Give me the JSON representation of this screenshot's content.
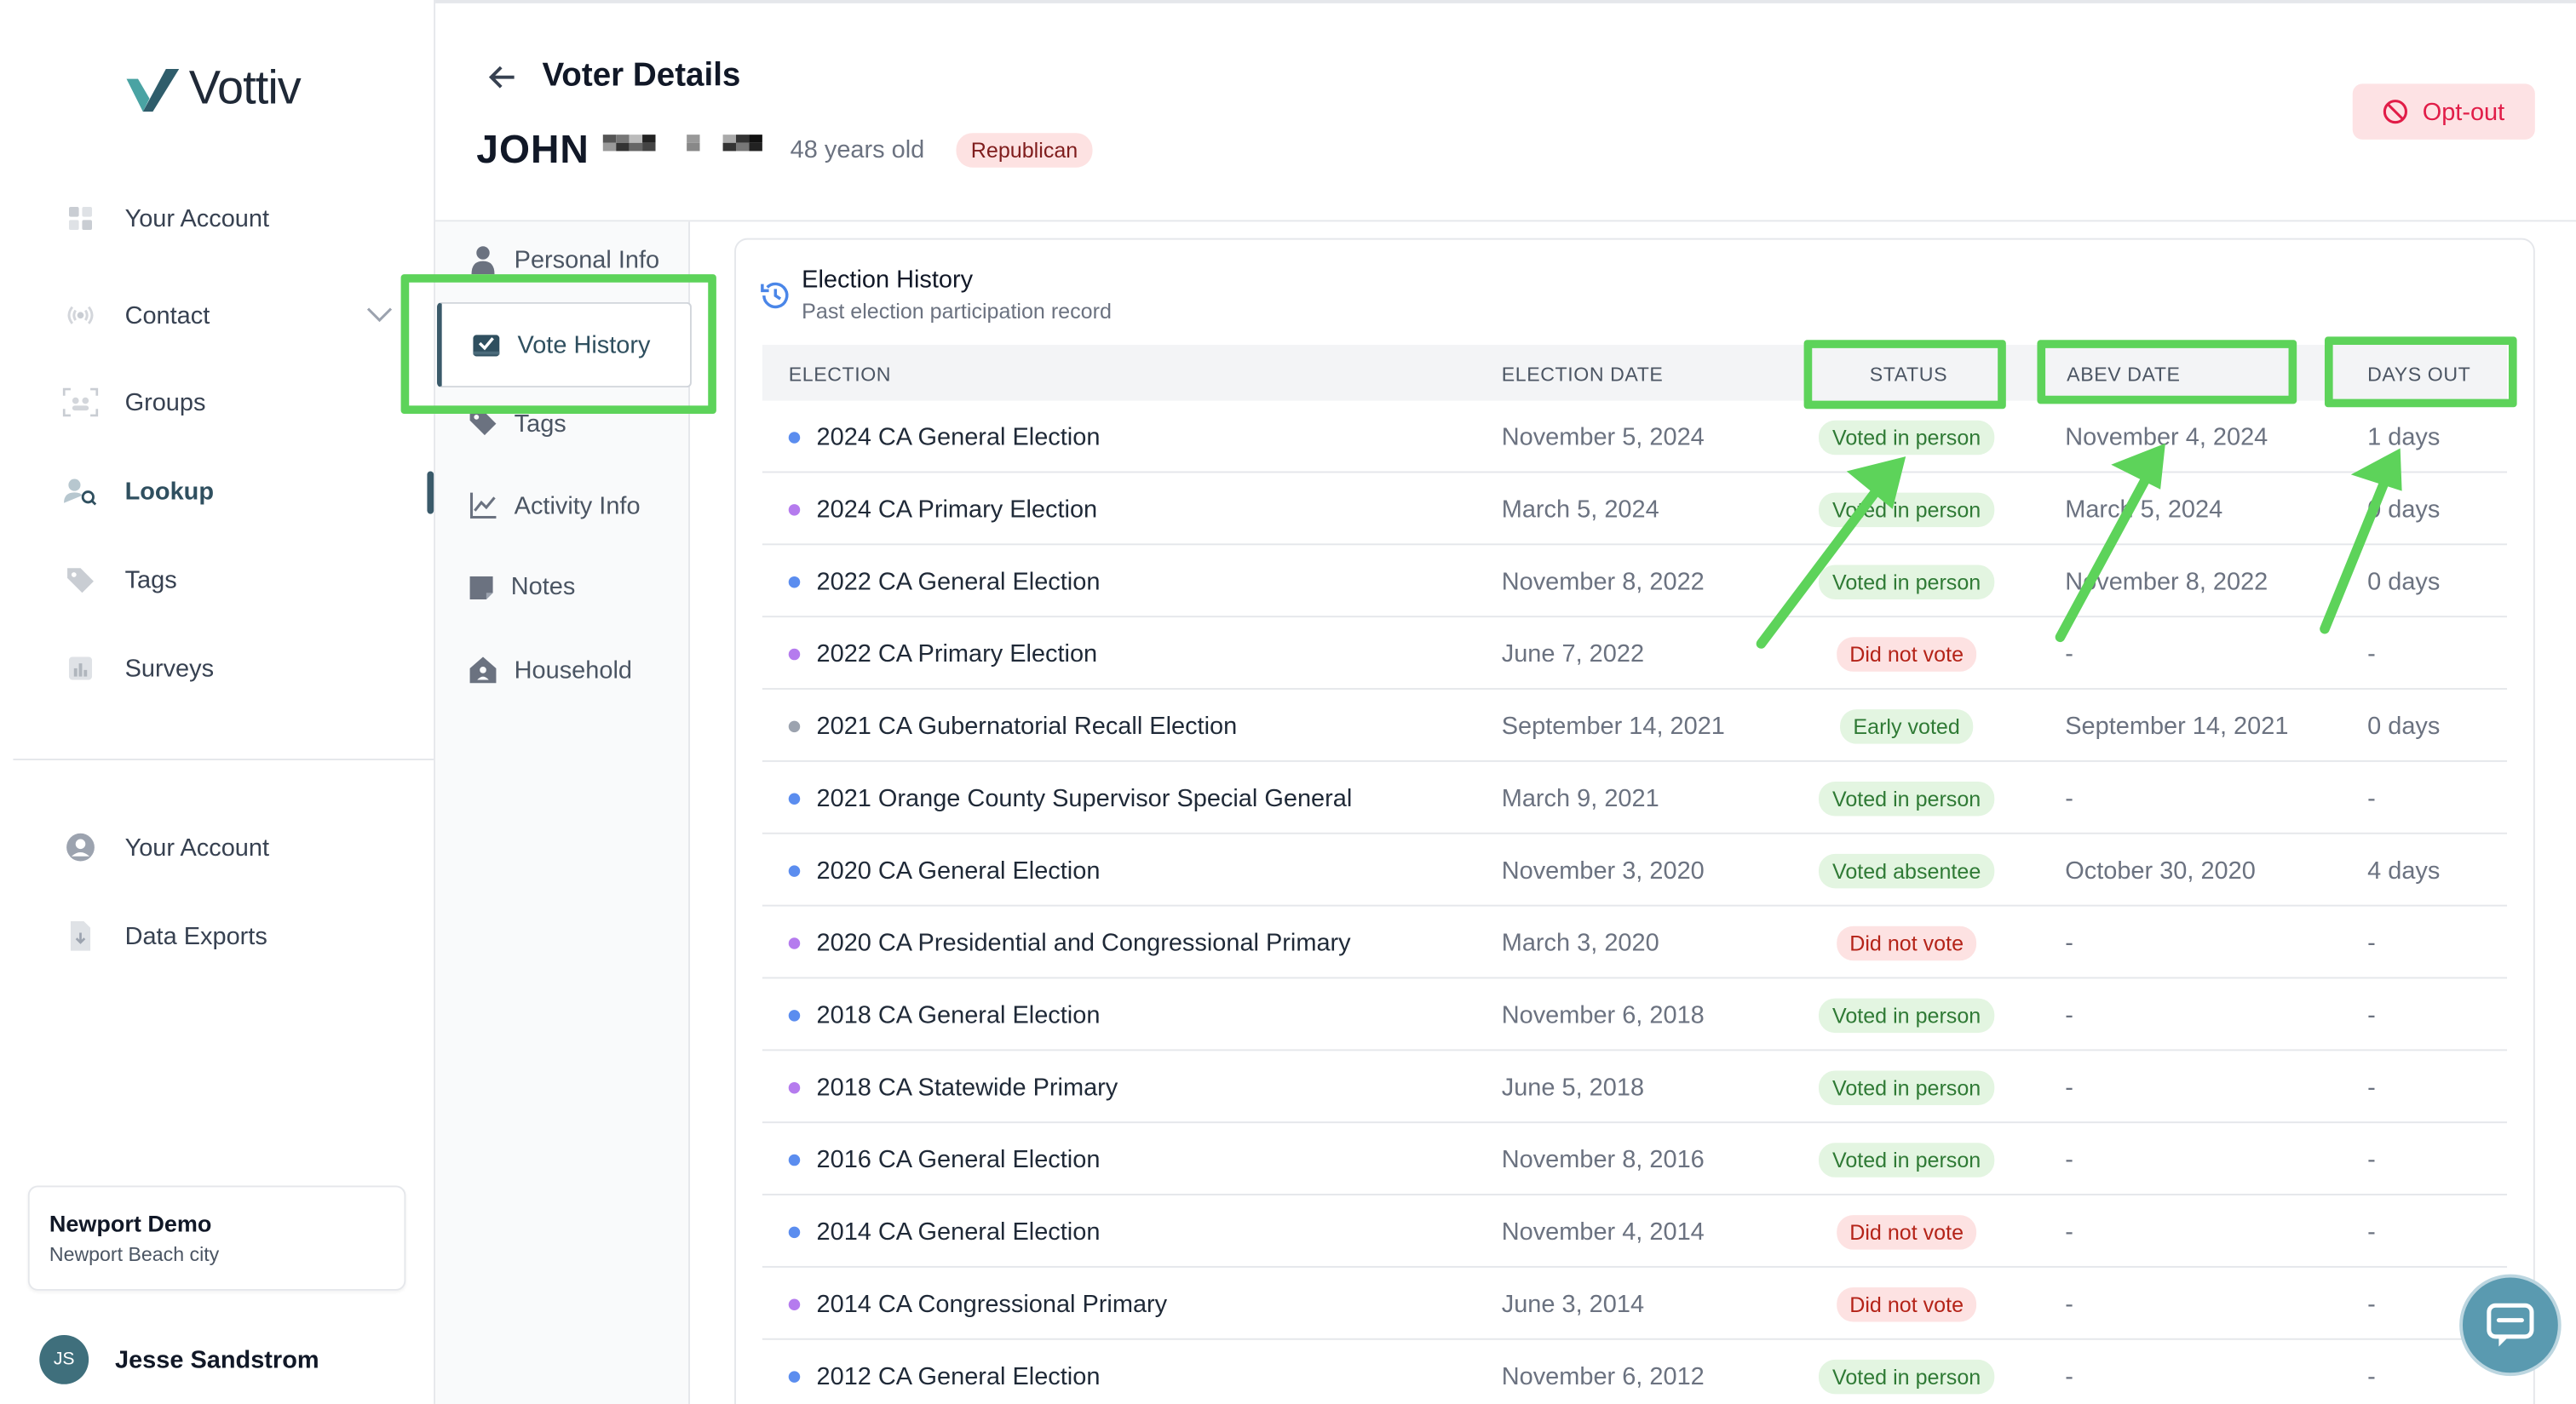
{
  "app": {
    "logo_text": "Vottiv"
  },
  "sidebar": {
    "items": [
      {
        "label": "Your Account",
        "icon": "dashboard-icon"
      },
      {
        "label": "Contact",
        "icon": "broadcast-icon"
      },
      {
        "label": "Groups",
        "icon": "groups-icon"
      },
      {
        "label": "Lookup",
        "icon": "user-search-icon",
        "active": true
      },
      {
        "label": "Tags",
        "icon": "tag-icon"
      },
      {
        "label": "Surveys",
        "icon": "bar-chart-icon"
      }
    ],
    "bottom_items": [
      {
        "label": "Your Account",
        "icon": "user-circle-icon"
      },
      {
        "label": "Data Exports",
        "icon": "file-download-icon"
      }
    ],
    "org": {
      "name": "Newport Demo",
      "subtitle": "Newport Beach city"
    },
    "user": {
      "initials": "JS",
      "name": "Jesse Sandstrom"
    }
  },
  "header": {
    "title": "Voter Details",
    "voter_first_name": "JOHN",
    "age": "48 years old",
    "party": "Republican",
    "optout_label": "Opt-out"
  },
  "subnav": {
    "items": [
      {
        "label": "Personal Info"
      },
      {
        "label": "Vote History",
        "active": true
      },
      {
        "label": "Tags"
      },
      {
        "label": "Activity Info"
      },
      {
        "label": "Notes"
      },
      {
        "label": "Household"
      }
    ]
  },
  "history": {
    "title": "Election History",
    "subtitle": "Past election participation record",
    "columns": [
      "ELECTION",
      "ELECTION DATE",
      "STATUS",
      "ABEV DATE",
      "DAYS OUT"
    ],
    "rows": [
      {
        "election": "2024 CA General Election",
        "type": "general",
        "date": "November 5, 2024",
        "status": "Voted in person",
        "abev": "November 4, 2024",
        "days": "1 days"
      },
      {
        "election": "2024 CA Primary Election",
        "type": "primary",
        "date": "March 5, 2024",
        "status": "Voted in person",
        "abev": "March 5, 2024",
        "days": "0 days"
      },
      {
        "election": "2022 CA General Election",
        "type": "general",
        "date": "November 8, 2022",
        "status": "Voted in person",
        "abev": "November 8, 2022",
        "days": "0 days"
      },
      {
        "election": "2022 CA Primary Election",
        "type": "primary",
        "date": "June 7, 2022",
        "status": "Did not vote",
        "abev": "-",
        "days": "-"
      },
      {
        "election": "2021 CA Gubernatorial Recall Election",
        "type": "special",
        "date": "September 14, 2021",
        "status": "Early voted",
        "abev": "September 14, 2021",
        "days": "0 days"
      },
      {
        "election": "2021 Orange County Supervisor Special General",
        "type": "general",
        "date": "March 9, 2021",
        "status": "Voted in person",
        "abev": "-",
        "days": "-"
      },
      {
        "election": "2020 CA General Election",
        "type": "general",
        "date": "November 3, 2020",
        "status": "Voted absentee",
        "abev": "October 30, 2020",
        "days": "4 days"
      },
      {
        "election": "2020 CA Presidential and Congressional Primary",
        "type": "primary",
        "date": "March 3, 2020",
        "status": "Did not vote",
        "abev": "-",
        "days": "-"
      },
      {
        "election": "2018 CA General Election",
        "type": "general",
        "date": "November 6, 2018",
        "status": "Voted in person",
        "abev": "-",
        "days": "-"
      },
      {
        "election": "2018 CA Statewide Primary",
        "type": "primary",
        "date": "June 5, 2018",
        "status": "Voted in person",
        "abev": "-",
        "days": "-"
      },
      {
        "election": "2016 CA General Election",
        "type": "general",
        "date": "November 8, 2016",
        "status": "Voted in person",
        "abev": "-",
        "days": "-"
      },
      {
        "election": "2014 CA General Election",
        "type": "general",
        "date": "November 4, 2014",
        "status": "Did not vote",
        "abev": "-",
        "days": "-"
      },
      {
        "election": "2014 CA Congressional Primary",
        "type": "primary",
        "date": "June 3, 2014",
        "status": "Did not vote",
        "abev": "-",
        "days": "-"
      },
      {
        "election": "2012 CA General Election",
        "type": "general",
        "date": "November 6, 2012",
        "status": "Voted in person",
        "abev": "-",
        "days": "-"
      }
    ]
  },
  "colors": {
    "general_dot": "#5b8def",
    "primary_dot": "#b57bee",
    "special_dot": "#9ca3af",
    "voted_bg": "#e3f5e1",
    "voted_text": "#2f7a35",
    "novote_bg": "#fde2e2",
    "novote_text": "#b42318",
    "annotation_green": "#5dd35a"
  }
}
